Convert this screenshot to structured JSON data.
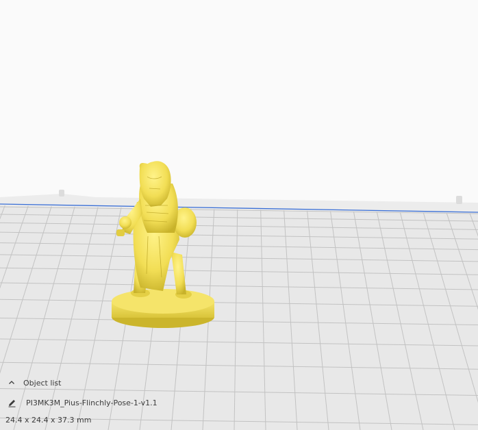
{
  "object_list": {
    "label": "Object list",
    "collapse_icon": "chevron-up-icon"
  },
  "object": {
    "name": "PI3MK3M_Pius-Flinchly-Pose-1-v1.1",
    "edit_icon": "pencil-icon"
  },
  "dimensions": "24.4 x 24.4 x 37.3 mm",
  "colors": {
    "background": "#fafafa",
    "build_plate": "#e6e6e6",
    "grid_line": "#c2c2c2",
    "build_volume_edge": "#3a6fd6",
    "model": "#f2de55",
    "model_shadow": "#c8b22a",
    "text": "#3b3b3b"
  }
}
